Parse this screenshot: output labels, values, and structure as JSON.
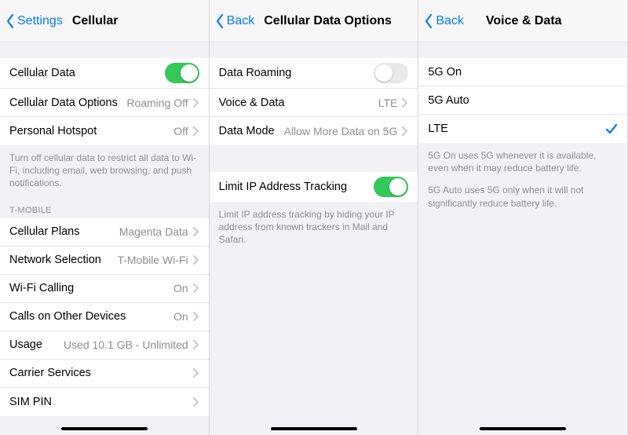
{
  "screen1": {
    "back": "Settings",
    "title": "Cellular",
    "rows": {
      "cellularData": "Cellular Data",
      "cellularDataOptions": {
        "label": "Cellular Data Options",
        "detail": "Roaming Off"
      },
      "personalHotspot": {
        "label": "Personal Hotspot",
        "detail": "Off"
      }
    },
    "footer1": "Turn off cellular data to restrict all data to Wi-Fi, including email, web browsing, and push notifications.",
    "carrierHeader": "T-MOBILE",
    "carrierRows": {
      "cellularPlans": {
        "label": "Cellular Plans",
        "detail": "Magenta Data"
      },
      "networkSelection": {
        "label": "Network Selection",
        "detail": "T-Mobile Wi-Fi"
      },
      "wifiCalling": {
        "label": "Wi-Fi Calling",
        "detail": "On"
      },
      "callsOther": {
        "label": "Calls on Other Devices",
        "detail": "On"
      },
      "usage": {
        "label": "Usage",
        "detail": "Used 10.1 GB - Unlimited"
      },
      "carrierServices": {
        "label": "Carrier Services",
        "detail": ""
      },
      "simPin": {
        "label": "SIM PIN",
        "detail": ""
      }
    }
  },
  "screen2": {
    "back": "Back",
    "title": "Cellular Data Options",
    "rows": {
      "dataRoaming": "Data Roaming",
      "voiceData": {
        "label": "Voice & Data",
        "detail": "LTE"
      },
      "dataMode": {
        "label": "Data Mode",
        "detail": "Allow More Data on 5G"
      }
    },
    "limitIp": "Limit IP Address Tracking",
    "limitIpFooter": "Limit IP address tracking by hiding your IP address from known trackers in Mail and Safari."
  },
  "screen3": {
    "back": "Back",
    "title": "Voice & Data",
    "options": {
      "fiveGOn": "5G On",
      "fiveGAuto": "5G Auto",
      "lte": "LTE"
    },
    "footer1": "5G On uses 5G whenever it is available, even when it may reduce battery life.",
    "footer2": "5G Auto uses 5G only when it will not significantly reduce battery life."
  }
}
